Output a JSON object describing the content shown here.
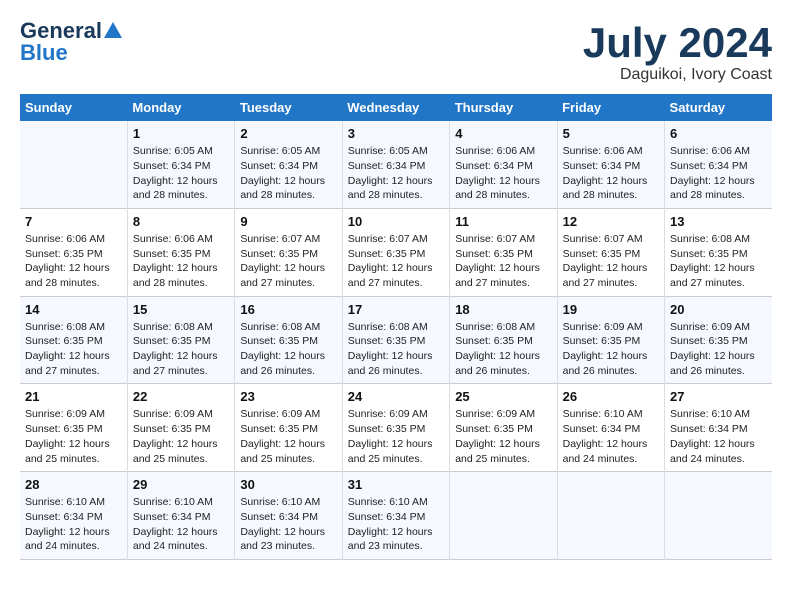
{
  "header": {
    "logo_general": "General",
    "logo_blue": "Blue",
    "month_year": "July 2024",
    "location": "Daguikoi, Ivory Coast"
  },
  "weekdays": [
    "Sunday",
    "Monday",
    "Tuesday",
    "Wednesday",
    "Thursday",
    "Friday",
    "Saturday"
  ],
  "weeks": [
    [
      {
        "day": "",
        "info": ""
      },
      {
        "day": "1",
        "info": "Sunrise: 6:05 AM\nSunset: 6:34 PM\nDaylight: 12 hours\nand 28 minutes."
      },
      {
        "day": "2",
        "info": "Sunrise: 6:05 AM\nSunset: 6:34 PM\nDaylight: 12 hours\nand 28 minutes."
      },
      {
        "day": "3",
        "info": "Sunrise: 6:05 AM\nSunset: 6:34 PM\nDaylight: 12 hours\nand 28 minutes."
      },
      {
        "day": "4",
        "info": "Sunrise: 6:06 AM\nSunset: 6:34 PM\nDaylight: 12 hours\nand 28 minutes."
      },
      {
        "day": "5",
        "info": "Sunrise: 6:06 AM\nSunset: 6:34 PM\nDaylight: 12 hours\nand 28 minutes."
      },
      {
        "day": "6",
        "info": "Sunrise: 6:06 AM\nSunset: 6:34 PM\nDaylight: 12 hours\nand 28 minutes."
      }
    ],
    [
      {
        "day": "7",
        "info": "Sunrise: 6:06 AM\nSunset: 6:35 PM\nDaylight: 12 hours\nand 28 minutes."
      },
      {
        "day": "8",
        "info": "Sunrise: 6:06 AM\nSunset: 6:35 PM\nDaylight: 12 hours\nand 28 minutes."
      },
      {
        "day": "9",
        "info": "Sunrise: 6:07 AM\nSunset: 6:35 PM\nDaylight: 12 hours\nand 27 minutes."
      },
      {
        "day": "10",
        "info": "Sunrise: 6:07 AM\nSunset: 6:35 PM\nDaylight: 12 hours\nand 27 minutes."
      },
      {
        "day": "11",
        "info": "Sunrise: 6:07 AM\nSunset: 6:35 PM\nDaylight: 12 hours\nand 27 minutes."
      },
      {
        "day": "12",
        "info": "Sunrise: 6:07 AM\nSunset: 6:35 PM\nDaylight: 12 hours\nand 27 minutes."
      },
      {
        "day": "13",
        "info": "Sunrise: 6:08 AM\nSunset: 6:35 PM\nDaylight: 12 hours\nand 27 minutes."
      }
    ],
    [
      {
        "day": "14",
        "info": "Sunrise: 6:08 AM\nSunset: 6:35 PM\nDaylight: 12 hours\nand 27 minutes."
      },
      {
        "day": "15",
        "info": "Sunrise: 6:08 AM\nSunset: 6:35 PM\nDaylight: 12 hours\nand 27 minutes."
      },
      {
        "day": "16",
        "info": "Sunrise: 6:08 AM\nSunset: 6:35 PM\nDaylight: 12 hours\nand 26 minutes."
      },
      {
        "day": "17",
        "info": "Sunrise: 6:08 AM\nSunset: 6:35 PM\nDaylight: 12 hours\nand 26 minutes."
      },
      {
        "day": "18",
        "info": "Sunrise: 6:08 AM\nSunset: 6:35 PM\nDaylight: 12 hours\nand 26 minutes."
      },
      {
        "day": "19",
        "info": "Sunrise: 6:09 AM\nSunset: 6:35 PM\nDaylight: 12 hours\nand 26 minutes."
      },
      {
        "day": "20",
        "info": "Sunrise: 6:09 AM\nSunset: 6:35 PM\nDaylight: 12 hours\nand 26 minutes."
      }
    ],
    [
      {
        "day": "21",
        "info": "Sunrise: 6:09 AM\nSunset: 6:35 PM\nDaylight: 12 hours\nand 25 minutes."
      },
      {
        "day": "22",
        "info": "Sunrise: 6:09 AM\nSunset: 6:35 PM\nDaylight: 12 hours\nand 25 minutes."
      },
      {
        "day": "23",
        "info": "Sunrise: 6:09 AM\nSunset: 6:35 PM\nDaylight: 12 hours\nand 25 minutes."
      },
      {
        "day": "24",
        "info": "Sunrise: 6:09 AM\nSunset: 6:35 PM\nDaylight: 12 hours\nand 25 minutes."
      },
      {
        "day": "25",
        "info": "Sunrise: 6:09 AM\nSunset: 6:35 PM\nDaylight: 12 hours\nand 25 minutes."
      },
      {
        "day": "26",
        "info": "Sunrise: 6:10 AM\nSunset: 6:34 PM\nDaylight: 12 hours\nand 24 minutes."
      },
      {
        "day": "27",
        "info": "Sunrise: 6:10 AM\nSunset: 6:34 PM\nDaylight: 12 hours\nand 24 minutes."
      }
    ],
    [
      {
        "day": "28",
        "info": "Sunrise: 6:10 AM\nSunset: 6:34 PM\nDaylight: 12 hours\nand 24 minutes."
      },
      {
        "day": "29",
        "info": "Sunrise: 6:10 AM\nSunset: 6:34 PM\nDaylight: 12 hours\nand 24 minutes."
      },
      {
        "day": "30",
        "info": "Sunrise: 6:10 AM\nSunset: 6:34 PM\nDaylight: 12 hours\nand 23 minutes."
      },
      {
        "day": "31",
        "info": "Sunrise: 6:10 AM\nSunset: 6:34 PM\nDaylight: 12 hours\nand 23 minutes."
      },
      {
        "day": "",
        "info": ""
      },
      {
        "day": "",
        "info": ""
      },
      {
        "day": "",
        "info": ""
      }
    ]
  ]
}
